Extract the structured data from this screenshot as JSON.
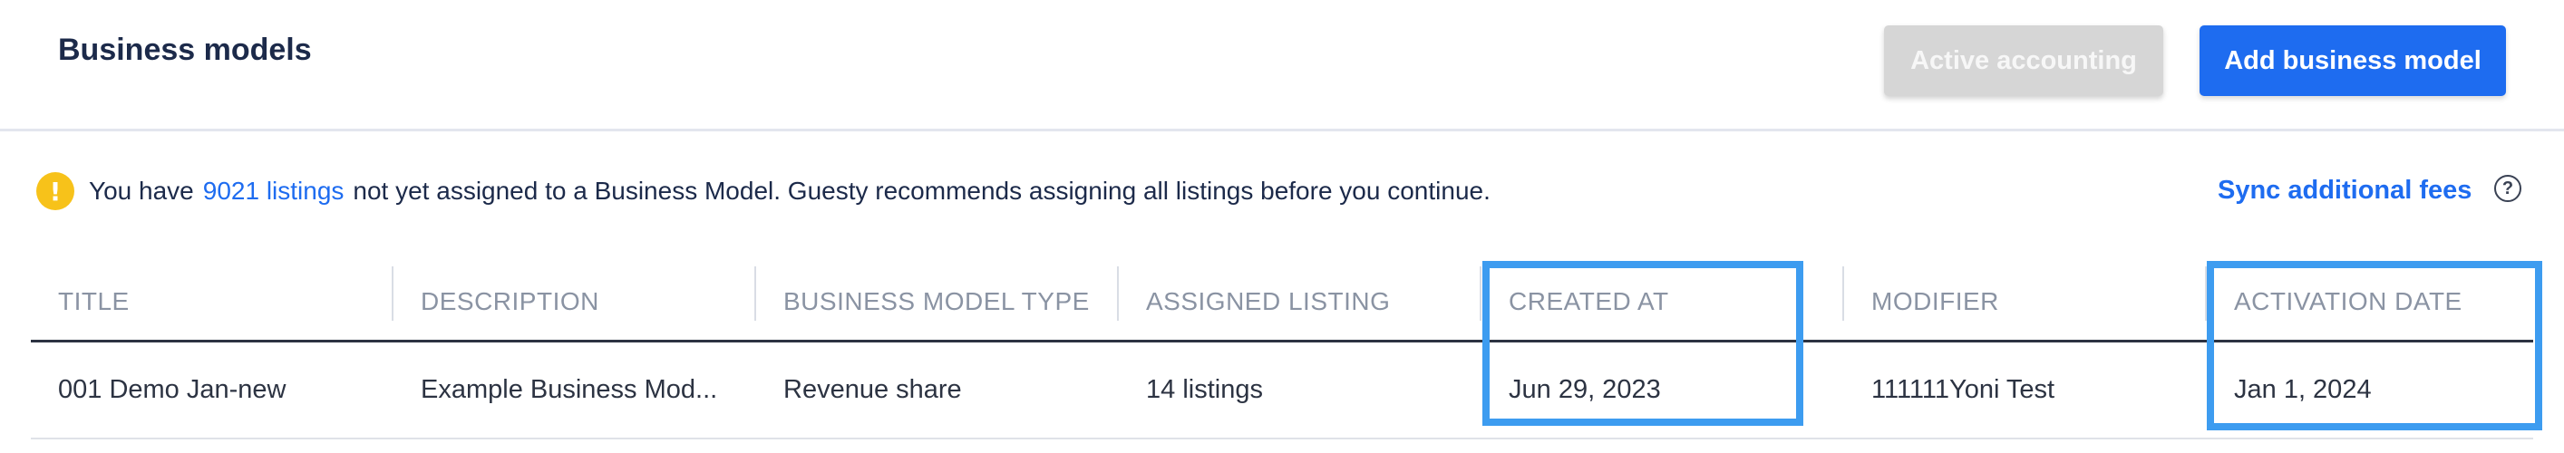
{
  "header": {
    "title": "Business models",
    "active_accounting_label": "Active accounting",
    "add_business_model_label": "Add business model"
  },
  "alert": {
    "icon": "warning-icon",
    "text_before": "You have",
    "link_text": "9021 listings",
    "text_after": "not yet assigned to a Business Model. Guesty recommends assigning all listings before you continue."
  },
  "sync": {
    "label": "Sync additional fees",
    "help_icon_glyph": "?"
  },
  "table": {
    "columns": [
      "TITLE",
      "DESCRIPTION",
      "BUSINESS MODEL TYPE",
      "ASSIGNED LISTING",
      "CREATED AT",
      "MODIFIER",
      "ACTIVATION DATE"
    ],
    "rows": [
      [
        "001 Demo Jan-new",
        "Example Business Mod...",
        "Revenue share",
        "14 listings",
        "Jun 29, 2023",
        "111111Yoni Test",
        "Jan 1, 2024"
      ]
    ]
  },
  "colors": {
    "primary": "#1e6cf0",
    "warning": "#f7c21a",
    "highlight": "#3d9cf0",
    "disabled": "#d6d6d6"
  }
}
